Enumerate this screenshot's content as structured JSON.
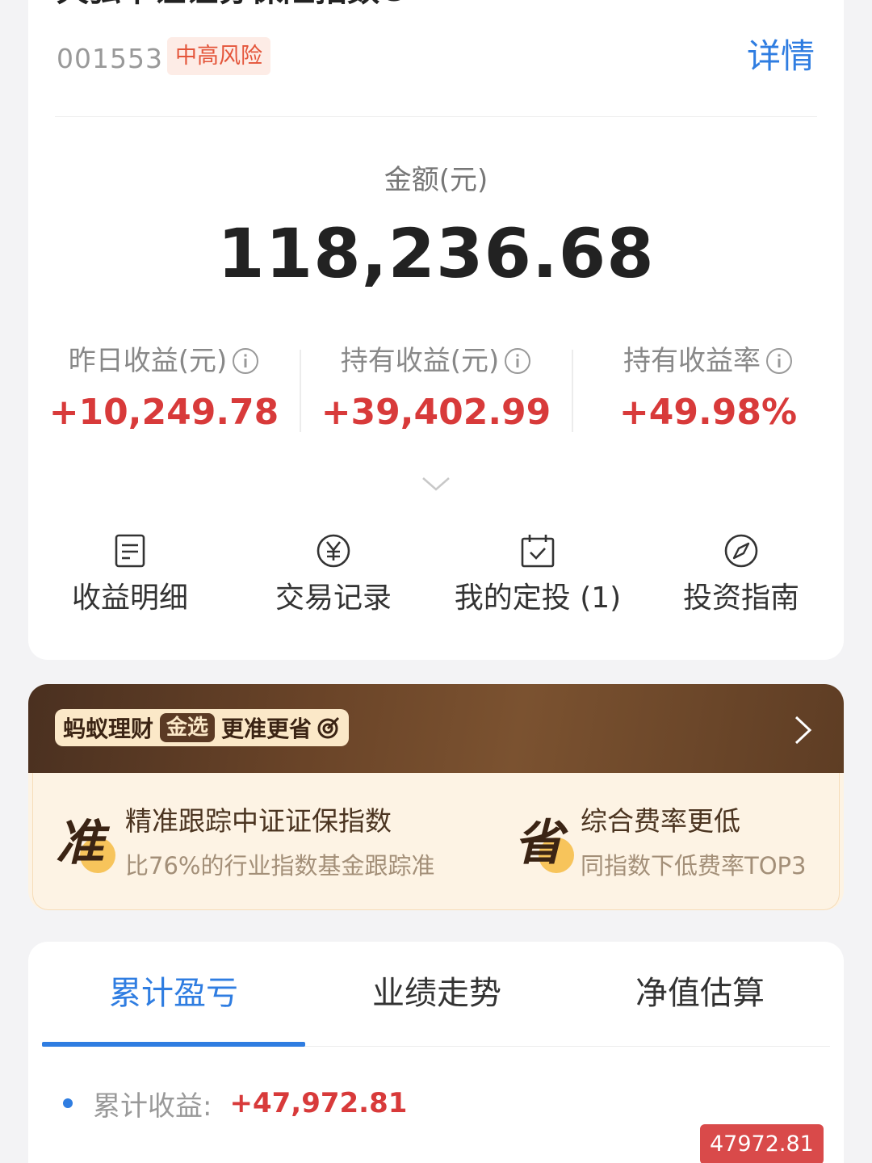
{
  "fund": {
    "title": "天弘中证证券保险指数C",
    "code": "001553",
    "risk_level": "中高风险",
    "detail_link": "详情"
  },
  "amount": {
    "label": "金额(元)",
    "value": "118,236.68"
  },
  "stats": [
    {
      "label": "昨日收益(元)",
      "value": "+10,249.78",
      "icon": "info-icon"
    },
    {
      "label": "持有收益(元)",
      "value": "+39,402.99",
      "icon": "info-icon"
    },
    {
      "label": "持有收益率",
      "value": "+49.98%",
      "icon": "info-icon"
    }
  ],
  "actions": [
    {
      "label": "收益明细",
      "icon": "document-icon"
    },
    {
      "label": "交易记录",
      "icon": "yen-icon"
    },
    {
      "label": "我的定投 (1)",
      "icon": "calendar-check-icon"
    },
    {
      "label": "投资指南",
      "icon": "compass-icon"
    }
  ],
  "promo": {
    "badge_left": "蚂蚁理财",
    "badge_pill": "金选",
    "badge_right": "更准更省",
    "items": [
      {
        "glyph": "准",
        "title": "精准跟踪中证证保指数",
        "subtitle": "比76%的行业指数基金跟踪准"
      },
      {
        "glyph": "省",
        "title": "综合费率更低",
        "subtitle": "同指数下低费率TOP3"
      }
    ]
  },
  "tabs": [
    {
      "label": "累计盈亏",
      "active": true
    },
    {
      "label": "业绩走势",
      "active": false
    },
    {
      "label": "净值估算",
      "active": false
    }
  ],
  "cumulative": {
    "label": "累计收益:",
    "value": "+47,972.81",
    "tooltip": "47972.81"
  },
  "colors": {
    "accent_blue": "#2f7de1",
    "gain_red": "#d83a3a",
    "risk_orange": "#e4553a",
    "promo_brown": "#6a4428"
  }
}
